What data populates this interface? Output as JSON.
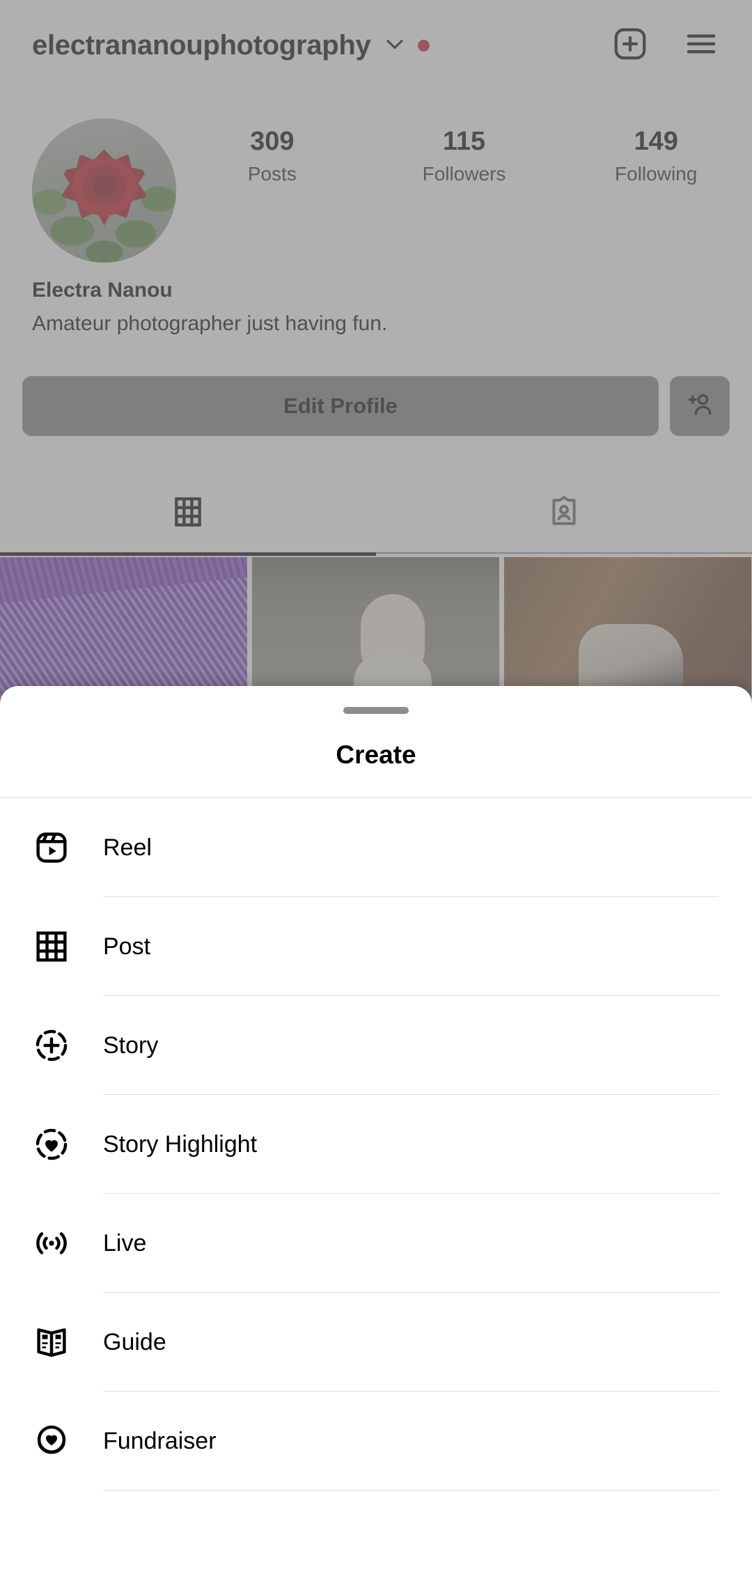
{
  "profile": {
    "header": {
      "username": "electrananouphotography",
      "chevron_icon": "chevron-down-icon",
      "status_dot_color": "#c8102e",
      "new_post_icon": "plus-square-icon",
      "menu_icon": "hamburger-menu-icon"
    },
    "avatar_icon": "profile-avatar-rose",
    "stats": [
      {
        "value": "309",
        "label": "Posts"
      },
      {
        "value": "115",
        "label": "Followers"
      },
      {
        "value": "149",
        "label": "Following"
      }
    ],
    "bio": {
      "display_name": "Electra Nanou",
      "description": "Amateur photographer just having fun."
    },
    "actions": {
      "edit_profile_label": "Edit Profile",
      "add_person_icon": "add-person-icon"
    },
    "tabs": [
      {
        "name": "grid-tab",
        "icon": "grid-icon",
        "active": true
      },
      {
        "name": "tagged-tab",
        "icon": "tagged-photos-icon",
        "active": false
      }
    ],
    "grid_posts": [
      {
        "name": "post-thumbnail-thistle",
        "alt": "purple thistle flower"
      },
      {
        "name": "post-thumbnail-dog-white",
        "alt": "white and tan dog on stone pavement"
      },
      {
        "name": "post-thumbnail-dog-black",
        "alt": "black and white dog beside wooden wall"
      }
    ]
  },
  "sheet": {
    "title": "Create",
    "drag_handle": "drag-handle",
    "items": [
      {
        "label": "Reel",
        "icon": "reel-icon"
      },
      {
        "label": "Post",
        "icon": "grid-post-icon"
      },
      {
        "label": "Story",
        "icon": "story-plus-icon"
      },
      {
        "label": "Story Highlight",
        "icon": "story-highlight-heart-icon"
      },
      {
        "label": "Live",
        "icon": "live-broadcast-icon"
      },
      {
        "label": "Guide",
        "icon": "guide-book-icon"
      },
      {
        "label": "Fundraiser",
        "icon": "fundraiser-heart-coin-icon"
      }
    ]
  },
  "colors": {
    "accent_red": "#c8102e",
    "text_primary": "#000000",
    "divider": "#dfdfdf",
    "overlay": "#808080"
  }
}
